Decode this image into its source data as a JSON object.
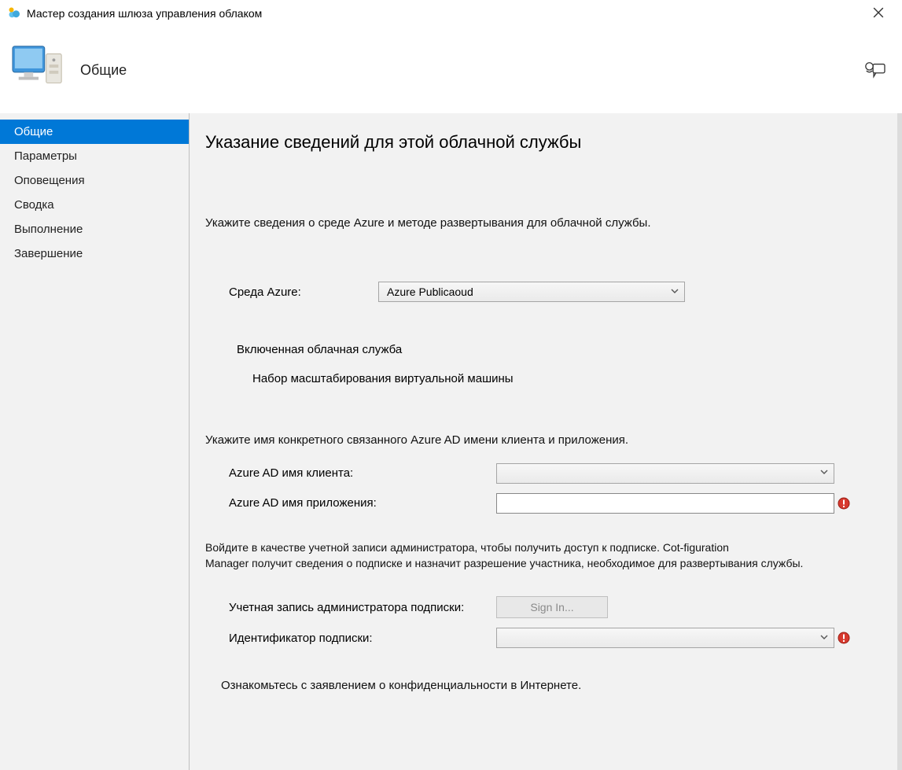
{
  "window": {
    "title": "Мастер создания шлюза управления облаком"
  },
  "banner": {
    "page_name": "Общие"
  },
  "sidebar": {
    "items": [
      {
        "label": "Общие",
        "active": true
      },
      {
        "label": "Параметры"
      },
      {
        "label": "Оповещения"
      },
      {
        "label": "Сводка"
      },
      {
        "label": "Выполнение"
      },
      {
        "label": "Завершение"
      }
    ]
  },
  "main": {
    "heading": "Указание сведений для этой облачной службы",
    "intro": "Укажите сведения о среде Azure и методе развертывания для облачной службы.",
    "azure_env_label": "Среда Azure:",
    "azure_env_value": "Azure Publicaoud",
    "enabled_cloud_service_label": "Включенная облачная служба",
    "vmscale_label": "Набор масштабирования виртуальной машины",
    "tenant_intro": "Укажите имя конкретного связанного Azure AD имени клиента и приложения.",
    "tenant_name_label": "Azure AD имя клиента:",
    "tenant_name_value": "",
    "app_name_label": "Azure AD имя приложения:",
    "app_name_value": "",
    "admin_intro_line1": "Войдите в качестве учетной записи администратора, чтобы получить доступ к подписке. Cot-figuration",
    "admin_intro_line2": "Manager получит сведения о подписке и назначит разрешение участника, необходимое для развертывания службы.",
    "admin_account_label": "Учетная запись администратора подписки:",
    "signin_label": "Sign In...",
    "subscription_id_label": "Идентификатор подписки:",
    "subscription_id_value": "",
    "privacy_text": "Ознакомьтесь с заявлением о конфиденциальности в Интернете."
  }
}
